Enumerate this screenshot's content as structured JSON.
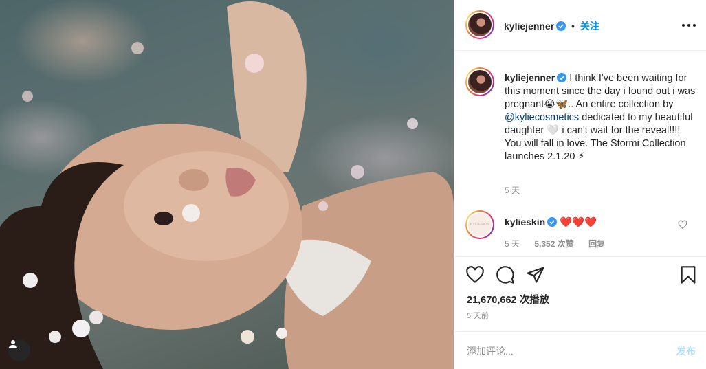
{
  "post": {
    "author": "kyliejenner",
    "follow_label": "关注",
    "separator": "•",
    "caption_text": "I think I've been waiting for this moment since the day i found out i was pregnant😭🦋.. An entire collection by ",
    "caption_mention": "@kyliecosmetics",
    "caption_rest": " dedicated to my beautiful daughter 🤍 i can't wait for the reveal!!!! You will fall in love. The Stormi Collection launches 2.1.20 ⚡",
    "caption_time": "5 天",
    "views": "21,670,662 次播放",
    "posted": "5 天前"
  },
  "comment": {
    "author": "kylieskin",
    "avatar_text": "KYLIESKIN",
    "text": "❤️❤️❤️",
    "time": "5 天",
    "likes": "5,352 次赞",
    "reply": "回复"
  },
  "compose": {
    "placeholder": "添加评论...",
    "post_label": "发布"
  },
  "colors": {
    "accent": "#0095f6",
    "post_disabled": "#b2dffc",
    "muted": "#8e8e8e"
  },
  "icons": [
    "heart-icon",
    "comment-icon",
    "share-icon",
    "bookmark-icon",
    "more-icon",
    "verified-icon",
    "user-icon"
  ]
}
